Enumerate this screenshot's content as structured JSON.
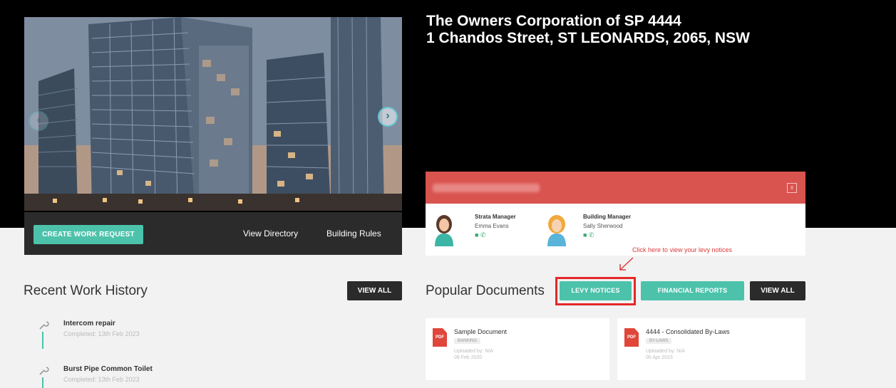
{
  "property": {
    "name": "The Owners Corporation of SP 4444",
    "address": "1 Chandos Street, ST LEONARDS, 2065, NSW"
  },
  "actions": {
    "create_work_request": "CREATE WORK REQUEST",
    "view_directory": "View Directory",
    "building_rules": "Building Rules"
  },
  "contacts": [
    {
      "role": "Strata Manager",
      "name": "Emma Evans"
    },
    {
      "role": "Building Manager",
      "name": "Sally Sherwood"
    }
  ],
  "hint": "Click here to view your levy notices",
  "work_history": {
    "title": "Recent Work History",
    "view_all": "VIEW ALL",
    "items": [
      {
        "title": "Intercom repair",
        "status": "Completed: 13th Feb 2023"
      },
      {
        "title": "Burst Pipe Common Toilet",
        "status": "Completed: 13th Feb 2023"
      }
    ]
  },
  "documents": {
    "title": "Popular Documents",
    "levy_notices": "LEVY NOTICES",
    "financial_reports": "FINANCIAL REPORTS",
    "view_all": "VIEW ALL",
    "items": [
      {
        "title": "Sample Document",
        "tag": "BANKING",
        "uploaded": "Uploaded by: N/A",
        "date": "09 Feb 2020"
      },
      {
        "title": "4444 - Consolidated By-Laws",
        "tag": "BY-LAWS",
        "uploaded": "Uploaded by: N/A",
        "date": "05 Apr 2023"
      }
    ]
  },
  "icons": {
    "pdf": "PDF",
    "close": "x",
    "prev": "‹",
    "next": "›"
  },
  "colors": {
    "accent": "#4cc2ab",
    "danger": "#d9534f",
    "dark": "#2b2b2b"
  }
}
